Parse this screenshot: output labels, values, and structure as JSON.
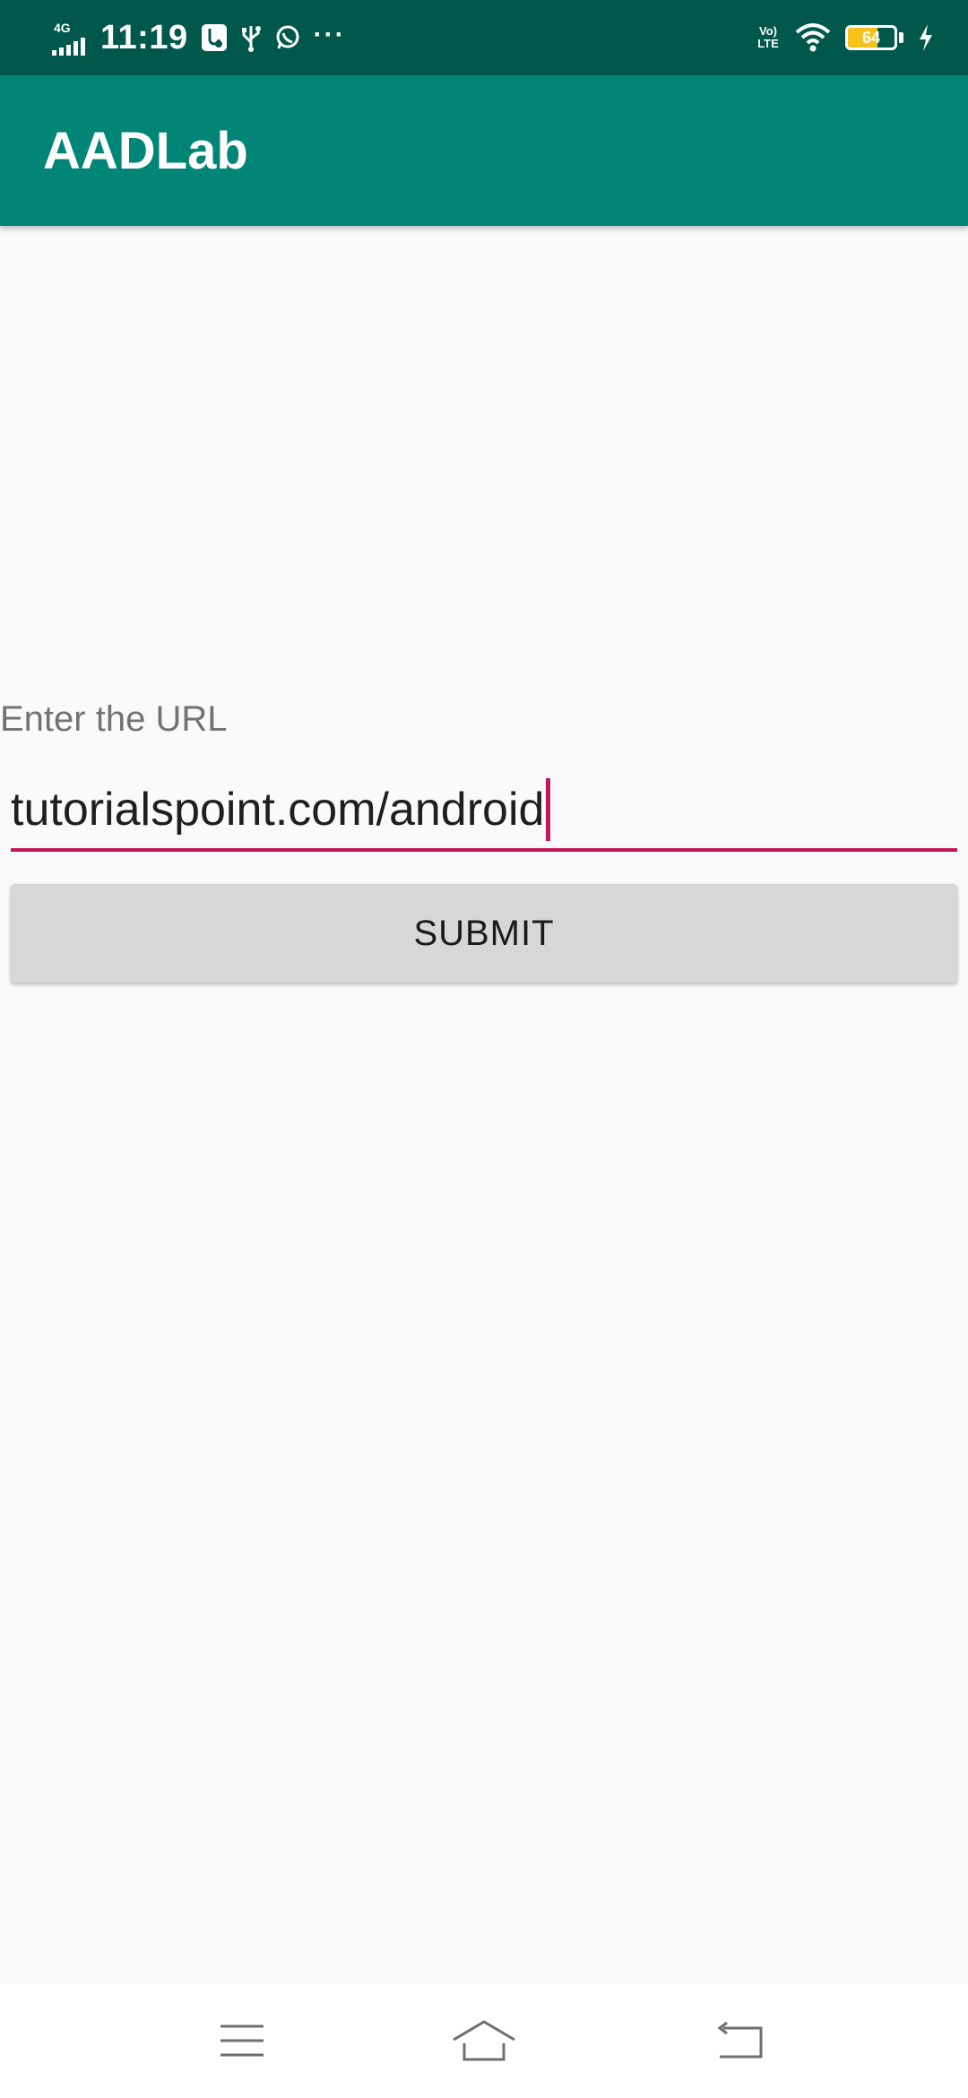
{
  "status_bar": {
    "time": "11:19",
    "network_type": "4G",
    "more_indicator": "···",
    "volte_top": "Vo)",
    "volte_bottom": "LTE",
    "battery_level": 64,
    "battery_text": "64",
    "icons": [
      "signal-icon",
      "usb-debug-icon",
      "usb-icon",
      "whatsapp-icon",
      "volte-icon",
      "wifi-icon",
      "battery-icon",
      "charging-icon"
    ]
  },
  "app_bar": {
    "title": "AADLab"
  },
  "form": {
    "label": "Enter the URL",
    "url_value": "tutorialspoint.com/android",
    "submit_label": "SUBMIT"
  },
  "nav_bar": {
    "buttons": [
      "menu-icon",
      "home-icon",
      "back-icon"
    ]
  },
  "colors": {
    "status_bar": "#00574b",
    "app_bar": "#008577",
    "accent": "#c2185b",
    "button": "#d6d7d7",
    "background": "#fafafa"
  }
}
